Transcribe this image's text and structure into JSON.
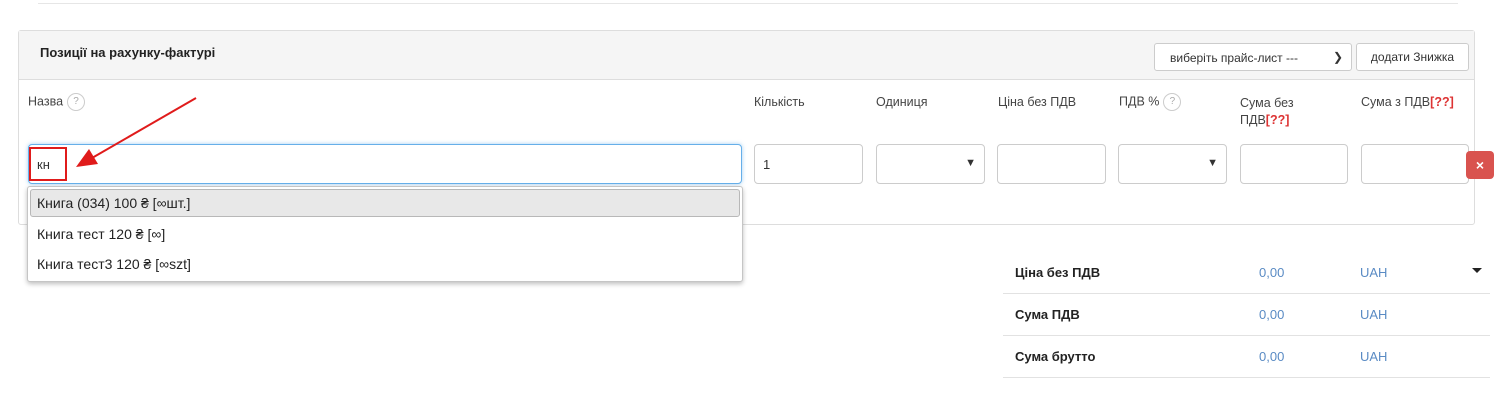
{
  "panel": {
    "title": "Позиції на рахунку-фактурі",
    "price_list_select": "виберіть прайс-лист ---",
    "add_discount": "додати Знижка"
  },
  "columns": {
    "name": "Назва",
    "quantity": "Кількість",
    "unit": "Одиниця",
    "price_net": "Ціна без ПДВ",
    "vat": "ПДВ %",
    "sum_net_line1": "Сума без",
    "sum_net_line2": "ПДВ",
    "sum_gross": "Сума з ПДВ",
    "marker": "[??]",
    "help": "?"
  },
  "row": {
    "name_value": "кн",
    "quantity_value": "1",
    "delete_icon": "×"
  },
  "suggestions": [
    "Книга (034) 100 ₴ [∞шт.]",
    "Книга тест 120 ₴ [∞]",
    "Книга тест3 120 ₴ [∞szt]"
  ],
  "totals": [
    {
      "label": "Ціна без ПДВ",
      "value": "0,00",
      "currency": "UAH"
    },
    {
      "label": "Сума ПДВ",
      "value": "0,00",
      "currency": "UAH"
    },
    {
      "label": "Сума брутто",
      "value": "0,00",
      "currency": "UAH"
    }
  ],
  "colors": {
    "annotation": "#e01b1b",
    "delete": "#d9534f",
    "totals_value": "#5a8bc4"
  }
}
